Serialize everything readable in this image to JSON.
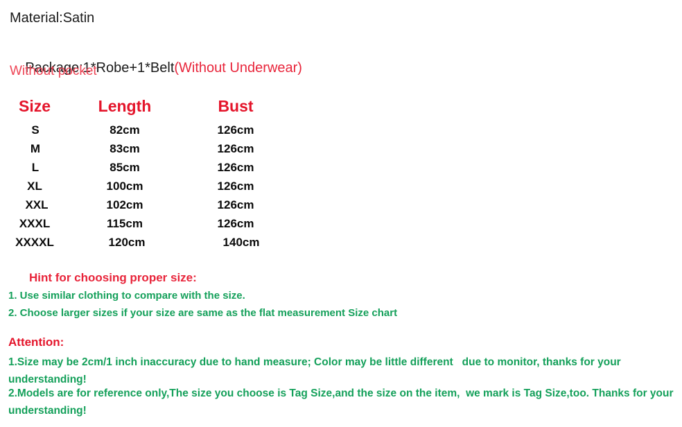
{
  "product_info": {
    "material_line": "Material:Satin",
    "package_line_black": "Package:1*Robe+1*Belt",
    "package_line_red": "(Without Underwear)",
    "pocket_line": "Without pocket"
  },
  "size_chart": {
    "headers": {
      "size": "Size",
      "length": "Length",
      "bust": "Bust"
    },
    "rows": [
      {
        "size": "S",
        "length": "82cm",
        "bust": "126cm"
      },
      {
        "size": "M",
        "length": "83cm",
        "bust": "126cm"
      },
      {
        "size": "L",
        "length": "85cm",
        "bust": "126cm"
      },
      {
        "size": "XL",
        "length": "100cm",
        "bust": "126cm"
      },
      {
        "size": "XXL",
        "length": "102cm",
        "bust": "126cm"
      },
      {
        "size": "XXXL",
        "length": "115cm",
        "bust": "126cm"
      },
      {
        "size": "XXXXL",
        "length": "120cm",
        "bust": "140cm"
      }
    ]
  },
  "hint": {
    "title": "Hint for choosing proper size:",
    "items": [
      "1. Use similar clothing to compare with the size.",
      "2. Choose larger sizes if your size are same as the flat measurement Size chart"
    ]
  },
  "attention": {
    "title": "Attention:",
    "items": [
      "1.Size may be 2cm/1 inch inaccuracy due to hand measure; Color may be little different   due to monitor, thanks for your understanding!",
      "2.Models are for reference only,The size you choose is Tag Size,and the size on the item,  we mark is Tag Size,too. Thanks for your understanding!"
    ]
  },
  "colors": {
    "red": "#e4142a",
    "red_light": "#ee4455",
    "green": "#14a05a",
    "black": "#0a0a0a",
    "background": "#ffffff"
  }
}
